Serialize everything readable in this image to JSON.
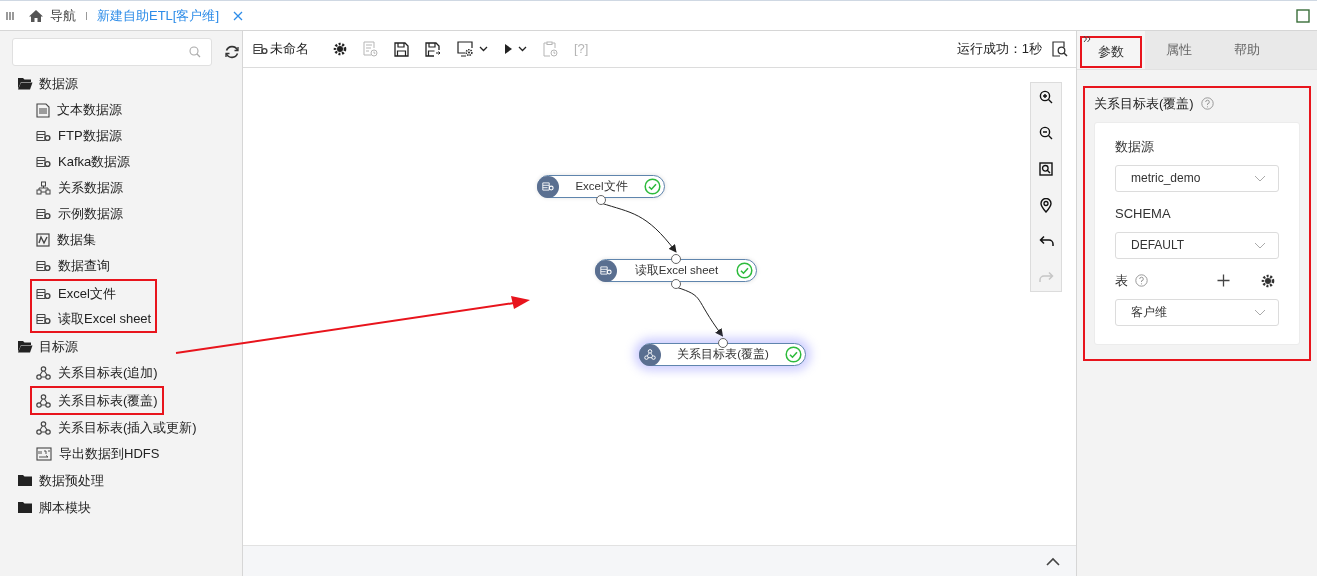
{
  "top_tabs": [
    {
      "kind": "home",
      "label": "导航",
      "selected": false,
      "closable": false
    },
    {
      "kind": "document",
      "label": "新建自助ETL[客户维]",
      "selected": true,
      "closable": true
    }
  ],
  "sidebar": {
    "groups": [
      {
        "label": "数据源",
        "expanded": true,
        "children": [
          {
            "label": "文本数据源",
            "kind": "text",
            "highlighted": false
          },
          {
            "label": "FTP数据源",
            "kind": "db",
            "highlighted": false
          },
          {
            "label": "Kafka数据源",
            "kind": "db",
            "highlighted": false
          },
          {
            "label": "关系数据源",
            "kind": "relational",
            "highlighted": false
          },
          {
            "label": "示例数据源",
            "kind": "db",
            "highlighted": false
          },
          {
            "label": "数据集",
            "kind": "dataset",
            "highlighted": false
          },
          {
            "label": "数据查询",
            "kind": "db",
            "highlighted": false
          },
          {
            "label": "Excel文件",
            "kind": "db",
            "highlighted": true
          },
          {
            "label": "读取Excel sheet",
            "kind": "db",
            "highlighted": true
          }
        ]
      },
      {
        "label": "目标源",
        "expanded": true,
        "children": [
          {
            "label": "关系目标表(追加)",
            "kind": "target",
            "highlighted": false
          },
          {
            "label": "关系目标表(覆盖)",
            "kind": "target",
            "highlighted": true
          },
          {
            "label": "关系目标表(插入或更新)",
            "kind": "target",
            "highlighted": false
          },
          {
            "label": "导出数据到HDFS",
            "kind": "hdfs",
            "highlighted": false
          }
        ]
      },
      {
        "label": "数据预处理",
        "expanded": false
      },
      {
        "label": "脚本模块",
        "expanded": false
      }
    ]
  },
  "toolbar": {
    "title": "未命名",
    "tools": [
      {
        "kind": "settings",
        "disabled": false,
        "dropdown": false
      },
      {
        "kind": "schedule",
        "disabled": true,
        "dropdown": false
      },
      {
        "kind": "save",
        "disabled": false,
        "dropdown": false
      },
      {
        "kind": "save_as",
        "disabled": false,
        "dropdown": false
      },
      {
        "kind": "config",
        "disabled": false,
        "dropdown": true
      },
      {
        "kind": "run",
        "disabled": false,
        "dropdown": true
      },
      {
        "kind": "clip_schedule",
        "disabled": true,
        "dropdown": false
      },
      {
        "kind": "help",
        "label": "[?]",
        "disabled": true,
        "dropdown": false
      }
    ],
    "status": "运行成功：1秒"
  },
  "canvas": {
    "nodes": [
      {
        "label": "Excel文件",
        "kind": "source",
        "succeeded": true,
        "selected": false,
        "input_connected": false
      },
      {
        "label": "读取Excel sheet",
        "kind": "source",
        "succeeded": true,
        "selected": false,
        "input_connected": true
      },
      {
        "label": "关系目标表(覆盖)",
        "kind": "target",
        "succeeded": true,
        "selected": true,
        "input_connected": true
      }
    ],
    "tools": [
      {
        "kind": "zoom_in",
        "disabled": false
      },
      {
        "kind": "zoom_out",
        "disabled": false
      },
      {
        "kind": "fit",
        "disabled": false
      },
      {
        "kind": "locate",
        "disabled": false
      },
      {
        "kind": "undo",
        "disabled": false
      },
      {
        "kind": "redo",
        "disabled": true
      }
    ]
  },
  "right_panel": {
    "tabs": [
      {
        "label": "参数",
        "selected": true,
        "highlighted": true
      },
      {
        "label": "属性",
        "selected": false,
        "highlighted": false
      },
      {
        "label": "帮助",
        "selected": false,
        "highlighted": false
      }
    ],
    "title": "关系目标表(覆盖)",
    "highlighted": true,
    "fields": [
      {
        "label": "数据源",
        "value": "metric_demo",
        "help": false,
        "actions": false
      },
      {
        "label": "SCHEMA",
        "value": "DEFAULT",
        "help": false,
        "actions": false
      },
      {
        "label": "表",
        "value": "客户维",
        "help": true,
        "actions": true
      }
    ]
  }
}
